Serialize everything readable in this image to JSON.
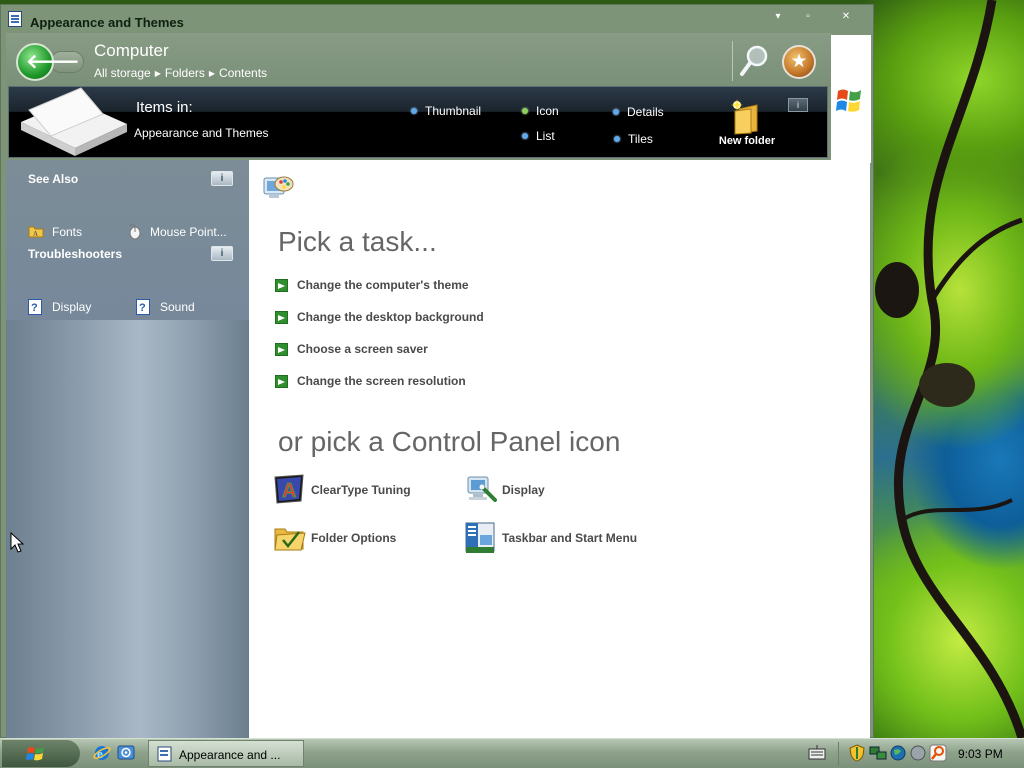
{
  "window": {
    "title": "Appearance and Themes",
    "controls": {
      "minimize": "▾",
      "restore": "▫",
      "close": "✕"
    }
  },
  "navbar": {
    "title": "Computer",
    "breadcrumb": [
      "All storage",
      "Folders",
      "Contents"
    ]
  },
  "toolbar": {
    "items_in_label": "Items in:",
    "items_in_value": "Appearance and Themes",
    "view_options": {
      "thumbnail": "Thumbnail",
      "icon": "Icon",
      "details": "Details",
      "list": "List",
      "tiles": "Tiles"
    },
    "new_folder_label": "New folder",
    "info_glyph": "i"
  },
  "sidebar": {
    "see_also": {
      "heading": "See Also",
      "items": [
        {
          "label": "Fonts",
          "icon": "fonts-folder-icon"
        },
        {
          "label": "Mouse Point...",
          "icon": "mouse-icon"
        }
      ]
    },
    "troubleshooters": {
      "heading": "Troubleshooters",
      "items": [
        {
          "label": "Display",
          "icon": "help-icon"
        },
        {
          "label": "Sound",
          "icon": "help-icon"
        }
      ]
    },
    "info_glyph": "i"
  },
  "content": {
    "task_heading": "Pick a task...",
    "tasks": [
      "Change the computer's theme",
      "Change the desktop background",
      "Choose a screen saver",
      "Change the screen resolution"
    ],
    "icon_heading": "or pick a Control Panel icon",
    "icons": [
      {
        "label": "ClearType Tuning",
        "icon": "cleartype-icon"
      },
      {
        "label": "Display",
        "icon": "display-icon"
      },
      {
        "label": "Folder Options",
        "icon": "folder-options-icon"
      },
      {
        "label": "Taskbar and Start Menu",
        "icon": "taskbar-icon"
      }
    ]
  },
  "taskbar": {
    "active_task": "Appearance and ...",
    "clock": "9:03 PM"
  },
  "colors": {
    "window_frame": "#7d9479",
    "toolbar": "#000000",
    "sidebar": "#8b9cac",
    "task_arrow": "#2f8f2f"
  }
}
